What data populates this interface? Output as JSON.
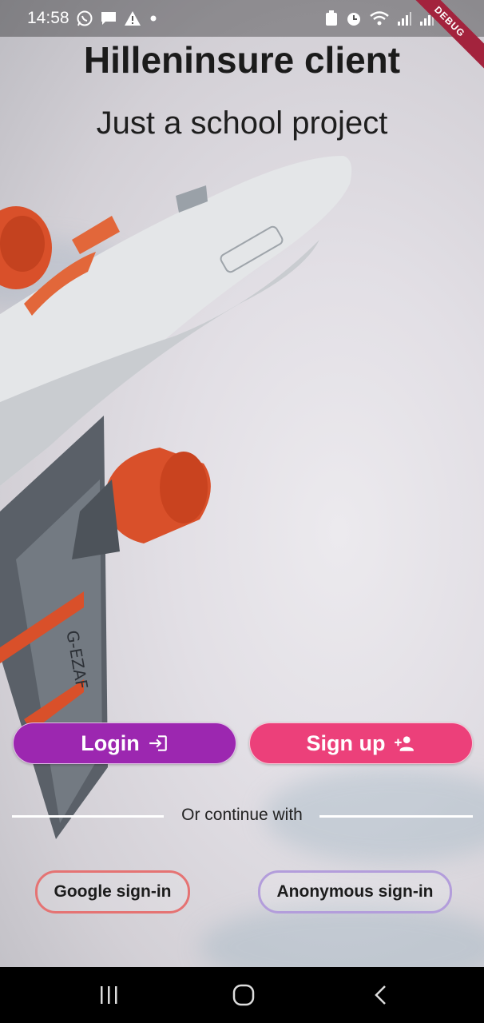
{
  "status_bar": {
    "time": "14:58",
    "left_icons": [
      "whatsapp-icon",
      "message-icon",
      "warning-icon",
      "dot-icon"
    ],
    "right_icons": [
      "battery-saver-icon",
      "alarm-icon",
      "wifi-icon",
      "signal-icon",
      "signal-icon",
      "battery-icon"
    ],
    "debug_banner": "DEBUG"
  },
  "header": {
    "title": "Hilleninsure client",
    "subtitle": "Just a school project"
  },
  "actions": {
    "login_label": "Login",
    "login_icon": "login-icon",
    "signup_label": "Sign up",
    "signup_icon": "person-add-icon",
    "login_color": "#9c27b0",
    "signup_color": "#ec407a"
  },
  "divider": {
    "text": "Or continue with"
  },
  "alt_signin": {
    "google_label": "Google sign-in",
    "anonymous_label": "Anonymous sign-in",
    "google_border": "#e57373",
    "anonymous_border": "#b39ddb"
  },
  "nav_bar": {
    "buttons": [
      "recent-apps-icon",
      "home-icon",
      "back-icon"
    ]
  }
}
